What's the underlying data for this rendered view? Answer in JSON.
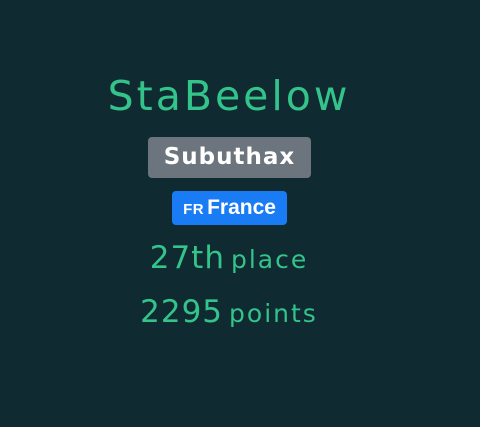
{
  "profile": {
    "username": "StaBeelow",
    "team": "Subuthax",
    "country": {
      "code": "FR",
      "name": "France",
      "badge_color": "#1a7cf5"
    },
    "rank": {
      "value": "27th",
      "label": "place"
    },
    "score": {
      "value": "2295",
      "label": "points"
    }
  },
  "colors": {
    "background": "#0f2a30",
    "accent": "#33c38b",
    "team_badge": "#6c757d"
  }
}
